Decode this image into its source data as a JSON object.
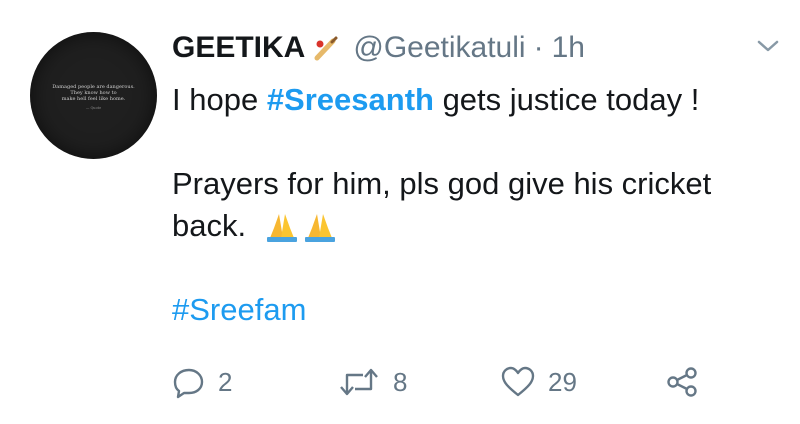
{
  "user": {
    "name": "GEETIKA",
    "handle": "@Geetikatuli",
    "separator": "·",
    "time": "1h",
    "avatar_text": [
      "Damaged people are dangerous.",
      "They know how to",
      "make hell feel like home.",
      "— Quote"
    ]
  },
  "tweet": {
    "line1": {
      "pre": "I hope ",
      "hashtag": "#Sreesanth",
      "post": " gets justice today !"
    },
    "line2": "Prayers for him, pls god give his cricket",
    "line3": "back.",
    "hashtag_line": "#Sreefam"
  },
  "actions": {
    "reply_count": "2",
    "retweet_count": "8",
    "like_count": "29"
  },
  "icons": {
    "badge": "cricket-bat-icon",
    "emoji": "folded-hands-icon",
    "menu": "chevron-down-icon",
    "reply": "reply-icon",
    "retweet": "retweet-icon",
    "like": "heart-icon",
    "share": "share-icon"
  },
  "colors": {
    "hashtag": "#1d9bf0",
    "secondary_text": "#657786",
    "primary_text": "#14171a"
  }
}
